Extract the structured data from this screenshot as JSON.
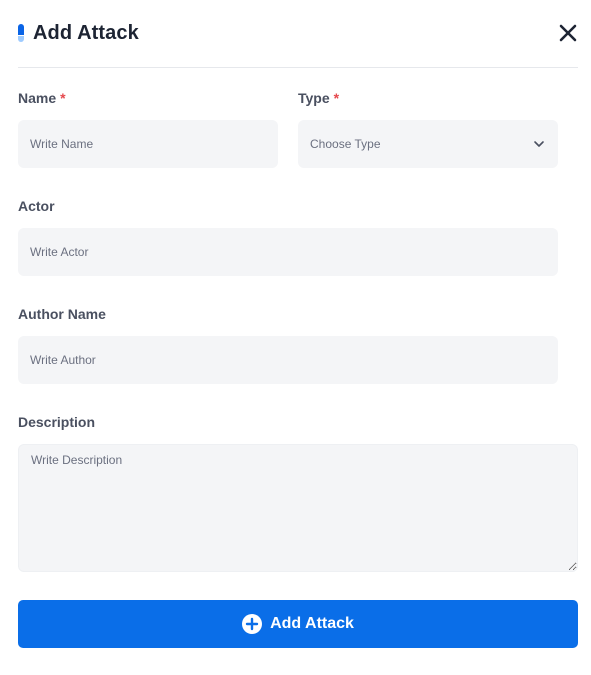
{
  "modal": {
    "title": "Add Attack",
    "close_icon": "close-icon",
    "accent_color": "#0a6ee8"
  },
  "fields": {
    "name": {
      "label": "Name",
      "required_mark": "*",
      "placeholder": "Write Name",
      "value": ""
    },
    "type": {
      "label": "Type",
      "required_mark": "*",
      "selected": "Choose Type",
      "icon": "chevron-down-icon"
    },
    "actor": {
      "label": "Actor",
      "placeholder": "Write Actor",
      "value": ""
    },
    "author": {
      "label": "Author Name",
      "placeholder": "Write Author",
      "value": ""
    },
    "description": {
      "label": "Description",
      "placeholder": "Write Description",
      "value": ""
    }
  },
  "submit": {
    "label": "Add Attack",
    "icon": "plus-circle-icon"
  }
}
